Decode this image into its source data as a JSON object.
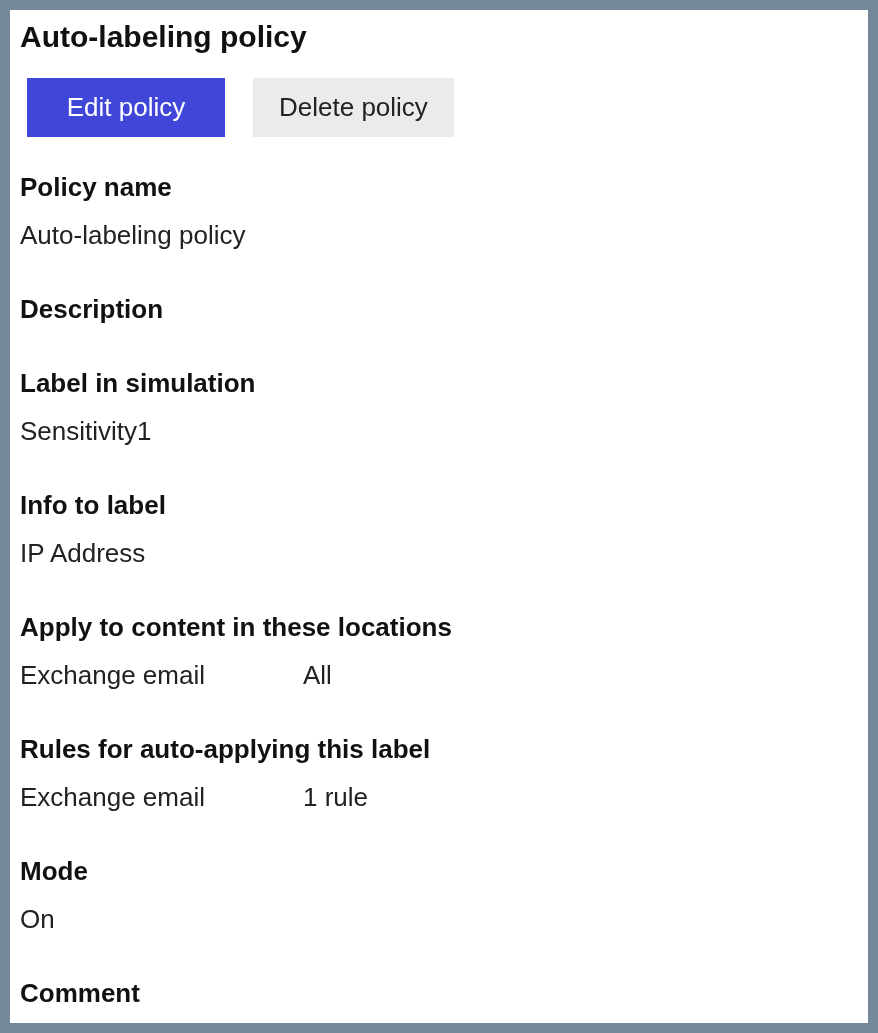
{
  "title": "Auto-labeling policy",
  "buttons": [
    {
      "label": "Edit policy",
      "kind": "primary"
    },
    {
      "label": "Delete policy",
      "kind": "default"
    }
  ],
  "fields": [
    {
      "label": "Policy name",
      "value": "Auto-labeling policy"
    },
    {
      "label": "Description"
    },
    {
      "label": "Label in simulation",
      "value": "Sensitivity1"
    },
    {
      "label": "Info to label",
      "value": "IP Address"
    },
    {
      "label": "Apply to content in these locations",
      "rows": [
        {
          "location": "Exchange email",
          "value": "All"
        }
      ]
    },
    {
      "label": "Rules for auto-applying this label",
      "rows": [
        {
          "location": "Exchange email",
          "value": "1 rule"
        }
      ]
    },
    {
      "label": "Mode",
      "value": "On"
    },
    {
      "label": "Comment"
    }
  ]
}
